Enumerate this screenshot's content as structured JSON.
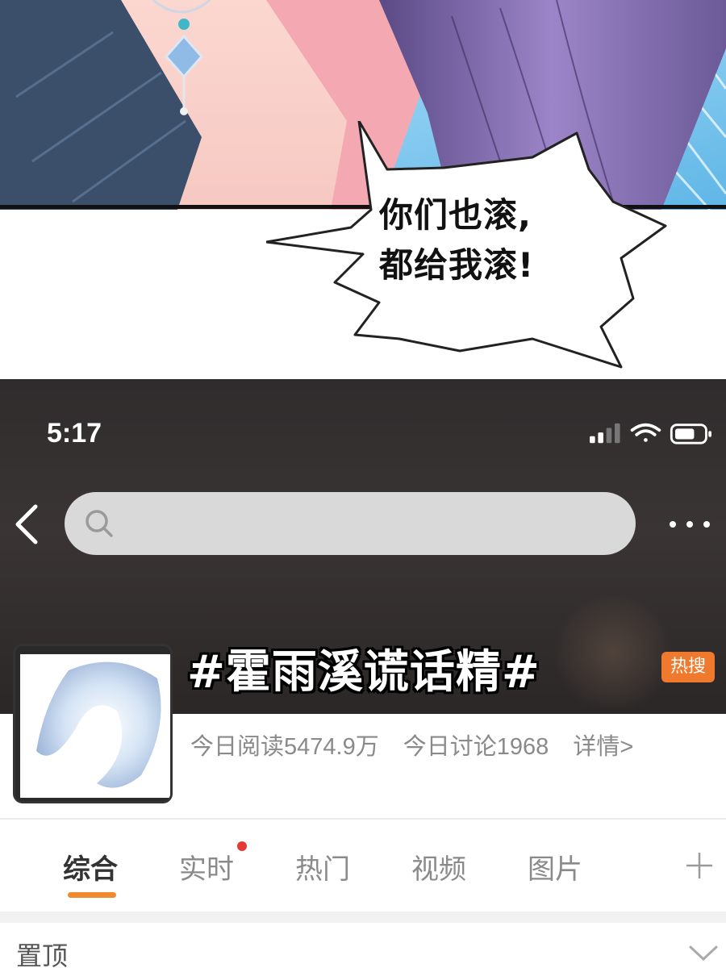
{
  "comic": {
    "speech_line1": "你们也滚,",
    "speech_line2": "都给我滚!"
  },
  "status_bar": {
    "time": "5:17",
    "icons": [
      "signal-icon",
      "wifi-icon",
      "battery-icon"
    ]
  },
  "search": {
    "placeholder": ""
  },
  "topic": {
    "title": "#霍雨溪谎话精#",
    "badge": "热搜",
    "reads": "今日阅读5474.9万",
    "discussions": "今日讨论1968",
    "details": "详情>"
  },
  "tabs": [
    {
      "label": "综合",
      "active": true
    },
    {
      "label": "实时",
      "active": false,
      "has_dot": true
    },
    {
      "label": "热门",
      "active": false
    },
    {
      "label": "视频",
      "active": false
    },
    {
      "label": "图片",
      "active": false
    }
  ],
  "section": {
    "pinned": "置顶"
  },
  "colors": {
    "accent": "#f08a2d",
    "hot_badge": "#ef7a2e",
    "notification_dot": "#e53935",
    "header_bg": "#2f2c2d"
  }
}
